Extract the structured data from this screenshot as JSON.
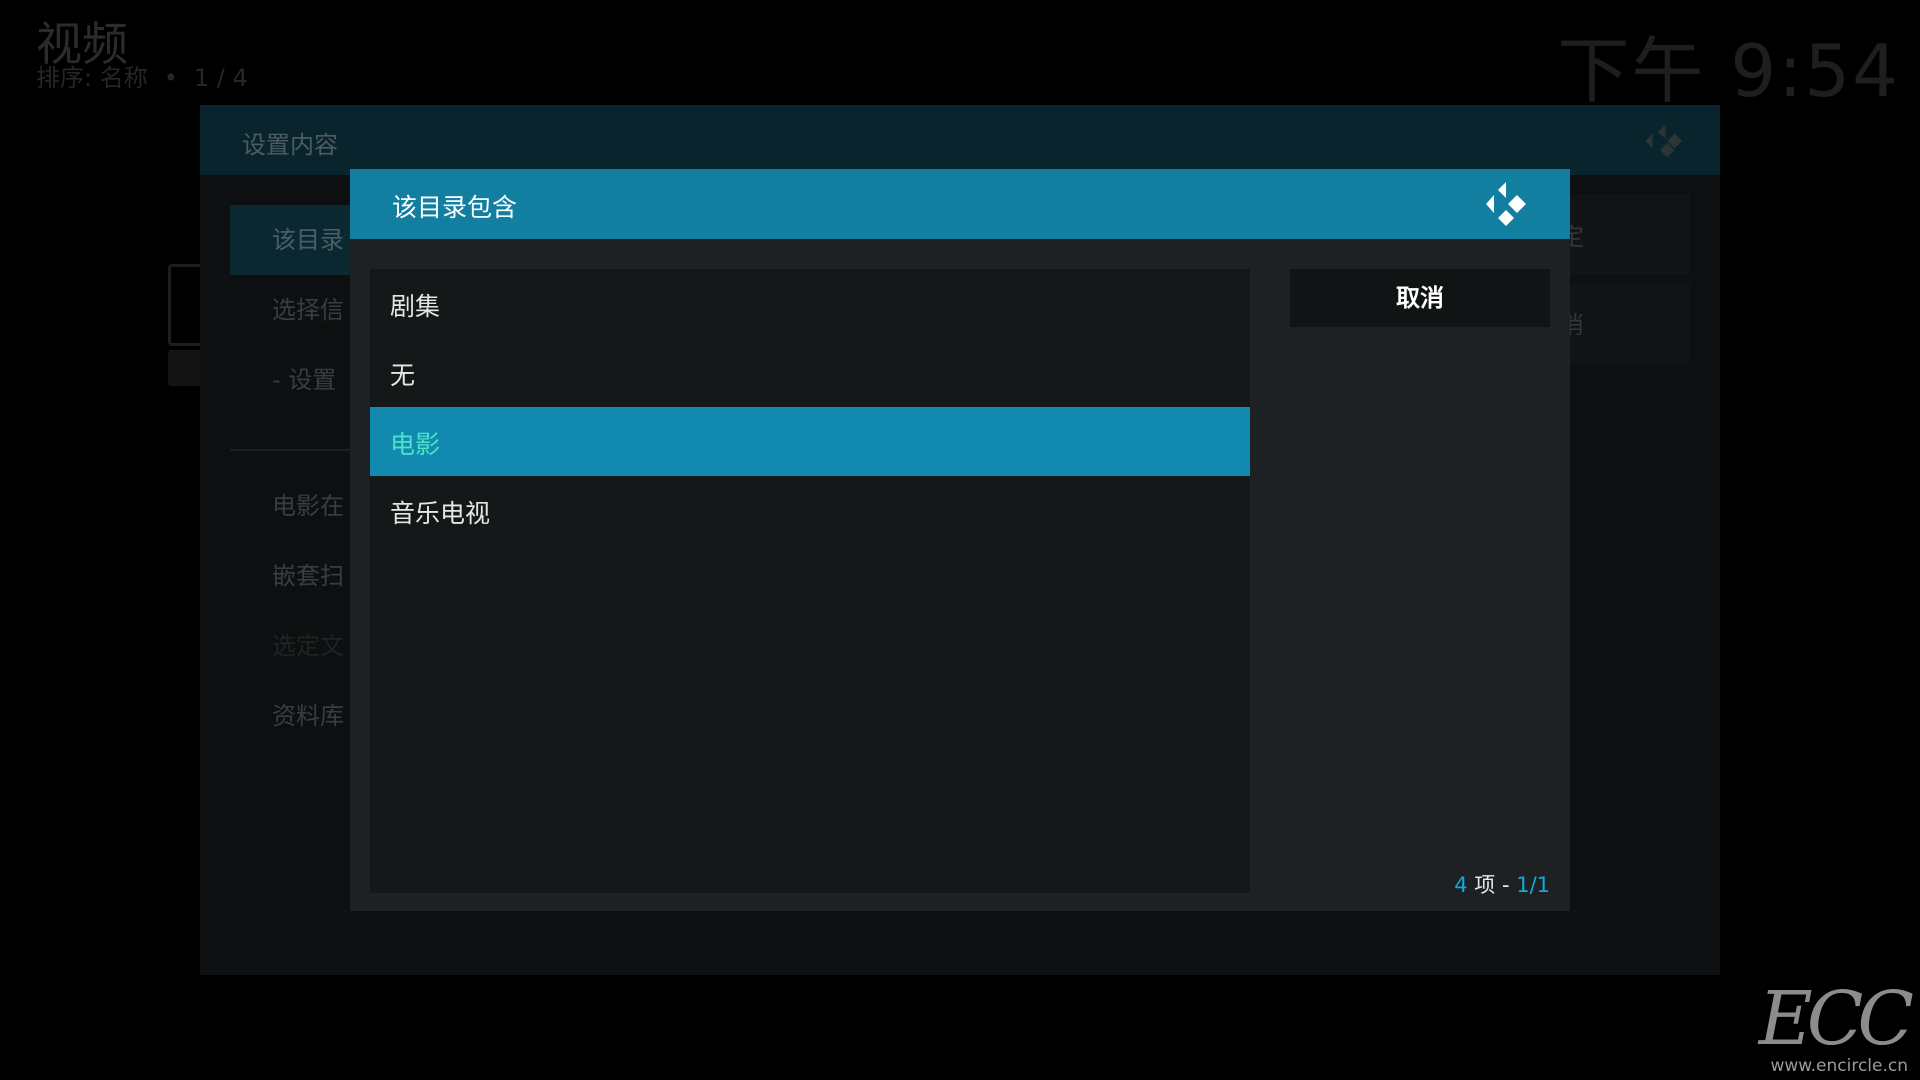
{
  "background": {
    "title": "视频",
    "sort_label": "排序: 名称",
    "page": "1 / 4",
    "clock": "下午 9:54"
  },
  "settings_dialog": {
    "title": "设置内容",
    "items": [
      {
        "label": "该目录"
      },
      {
        "label": "选择信"
      },
      {
        "label": "- 设置"
      },
      {
        "label": "电影在"
      },
      {
        "label": "嵌套扫"
      },
      {
        "label": "选定文"
      },
      {
        "label": "资料库"
      }
    ],
    "ok_label": "定",
    "cancel_label": "消"
  },
  "select_dialog": {
    "title": "该目录包含",
    "options": [
      {
        "label": "剧集"
      },
      {
        "label": "无"
      },
      {
        "label": "电影"
      },
      {
        "label": "音乐电视"
      }
    ],
    "selected_index": 2,
    "cancel_label": "取消",
    "counter": {
      "count": "4",
      "unit": "项",
      "separator": "-",
      "page": "1/1"
    }
  },
  "watermark": {
    "logo": "ECC",
    "url": "www.encircle.cn"
  },
  "colors": {
    "header_blue": "#127fa1",
    "selected_blue": "#128ab0",
    "selected_text": "#4be2c9",
    "counter_accent": "#14a9d6"
  },
  "icons": {
    "dialog_logo": "kodi-logo-icon"
  }
}
